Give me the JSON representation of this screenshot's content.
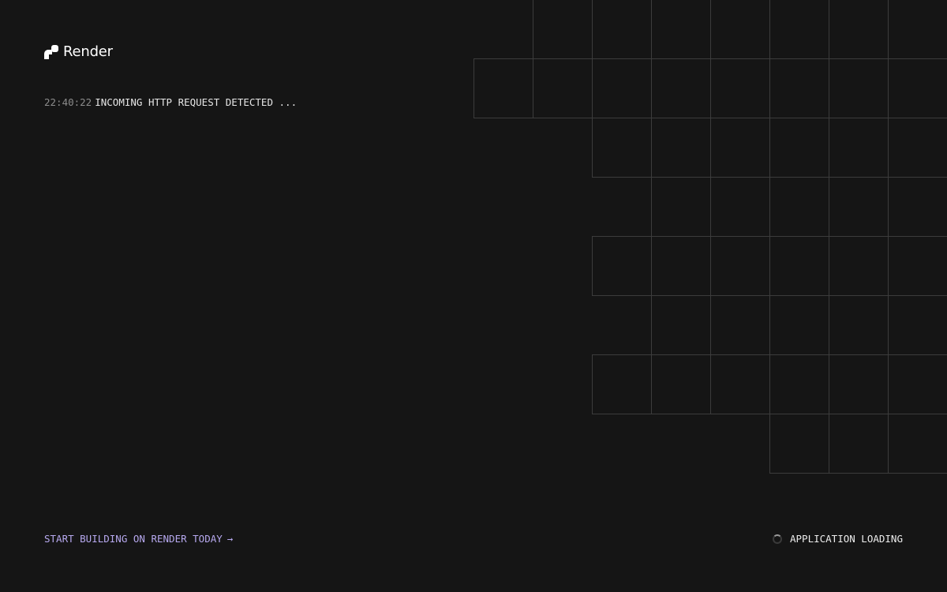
{
  "brand": {
    "name": "Render",
    "logo_icon": "render-logo-icon"
  },
  "log": {
    "time": "22:40:22",
    "message": "INCOMING HTTP REQUEST DETECTED ..."
  },
  "footer": {
    "cta_label": "START BUILDING ON RENDER TODAY",
    "cta_arrow": "→",
    "status_label": "APPLICATION LOADING",
    "status_icon": "spinner-icon"
  },
  "colors": {
    "background": "#151515",
    "grid_line": "#3c3c3c",
    "accent": "#b6a8ee"
  }
}
